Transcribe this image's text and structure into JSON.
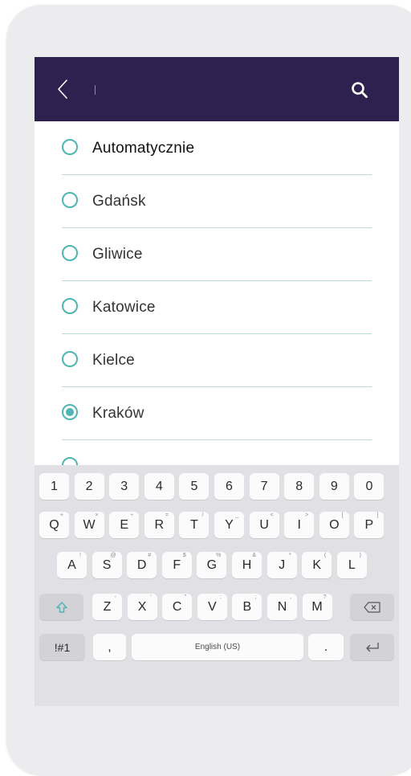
{
  "header": {
    "search_value": "",
    "icons": {
      "back": "chevron-left-icon",
      "search": "search-icon"
    }
  },
  "cities": [
    {
      "label": "Automatycznie",
      "selected": false
    },
    {
      "label": "Gdańsk",
      "selected": false
    },
    {
      "label": "Gliwice",
      "selected": false
    },
    {
      "label": "Katowice",
      "selected": false
    },
    {
      "label": "Kielce",
      "selected": false
    },
    {
      "label": "Kraków",
      "selected": true
    }
  ],
  "keyboard": {
    "numbers": [
      "1",
      "2",
      "3",
      "4",
      "5",
      "6",
      "7",
      "8",
      "9",
      "0"
    ],
    "row1": [
      "Q",
      "W",
      "E",
      "R",
      "T",
      "Y",
      "U",
      "I",
      "O",
      "P"
    ],
    "row1_alt": [
      "+",
      "×",
      "÷",
      "=",
      "/",
      "_",
      "<",
      ">",
      "[",
      "]"
    ],
    "row2": [
      "A",
      "S",
      "D",
      "F",
      "G",
      "H",
      "J",
      "K",
      "L"
    ],
    "row2_alt": [
      "!",
      "@",
      "#",
      "$",
      "%",
      "&",
      "*",
      "(",
      ")"
    ],
    "row3": [
      "Z",
      "X",
      "C",
      "V",
      "B",
      "N",
      "M"
    ],
    "row3_alt": [
      "-",
      "'",
      "\"",
      ":",
      ";",
      ",",
      "?"
    ],
    "sym_label": "!#1",
    "comma": ",",
    "space_label": "English (US)",
    "period": ".",
    "icons": {
      "shift": "shift-arrow-icon",
      "backspace": "backspace-icon",
      "enter": "enter-icon"
    }
  },
  "colors": {
    "appbar": "#2e2150",
    "accent": "#4fb5b0",
    "divider": "#b9dcda",
    "keyboard_bg": "#e1e0e4"
  }
}
